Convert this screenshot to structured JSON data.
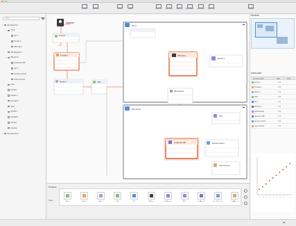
{
  "window": {
    "title": "",
    "traffic": [
      "#f2605a",
      "#f6be4f",
      "#5ec86e"
    ]
  },
  "toolbar": {
    "items": [
      {
        "label": "Connect",
        "icon": "connect-icon"
      },
      {
        "label": "Generate",
        "icon": "generate-icon"
      },
      {
        "label": "Search",
        "icon": "search-icon"
      },
      {
        "label": "Select",
        "icon": "pointer-icon"
      },
      {
        "label": "Align Left",
        "icon": "align-left-icon"
      },
      {
        "label": "Align Right",
        "icon": "align-right-icon"
      },
      {
        "label": "Align Top",
        "icon": "align-top-icon"
      },
      {
        "label": "Align Bottom",
        "icon": "align-bottom-icon"
      },
      {
        "label": "Space Horiz.",
        "icon": "space-horizontal-icon"
      },
      {
        "label": "Space Vert.",
        "icon": "space-vertical-icon"
      },
      {
        "label": "Inspector",
        "icon": "inspector-icon"
      }
    ]
  },
  "sidebar": {
    "search_placeholder": "Filter",
    "items": [
      {
        "label": "My Network 1",
        "level": 0,
        "twisty": "▾"
      },
      {
        "label": "DC 2",
        "level": 1,
        "twisty": "▾"
      },
      {
        "label": "AP 1",
        "level": 2,
        "twisty": ""
      },
      {
        "label": "Router 1",
        "level": 2,
        "twisty": ""
      },
      {
        "label": "DB Client",
        "level": 2,
        "twisty": ""
      },
      {
        "label": "DB Requests",
        "level": 1,
        "twisty": ""
      },
      {
        "label": "DB server",
        "level": 1,
        "twisty": "▾"
      },
      {
        "label": "Customer DB",
        "level": 2,
        "twisty": ""
      },
      {
        "label": "AP 2",
        "level": 2,
        "twisty": ""
      },
      {
        "label": "Access Control",
        "level": 2,
        "twisty": ""
      },
      {
        "label": "User Account",
        "level": 2,
        "twisty": ""
      },
      {
        "label": "User",
        "level": 1,
        "twisty": ""
      },
      {
        "label": "Internet",
        "level": 1,
        "twisty": ""
      },
      {
        "label": "Router 2",
        "level": 1,
        "twisty": ""
      },
      {
        "label": "Firewall 2",
        "level": 1,
        "twisty": ""
      },
      {
        "label": "SW1",
        "level": 1,
        "twisty": ""
      },
      {
        "label": "Router 1",
        "level": 1,
        "twisty": ""
      },
      {
        "label": "Firewall 1",
        "level": 1,
        "twisty": ""
      },
      {
        "label": "Internet",
        "level": 1,
        "twisty": ""
      },
      {
        "label": "Attacker",
        "level": 1,
        "twisty": ""
      },
      {
        "label": "My Network 2",
        "level": 0,
        "twisty": "▸"
      }
    ]
  },
  "canvas": {
    "attacker": "Attacker",
    "internet": "Internet",
    "firewall": "Firewall 1",
    "router": "Router 1",
    "sw": "SW2",
    "dc2": "DC 2",
    "dbclient": "DB Client",
    "router_right": "Router 1",
    "dbrequests": "DB requests",
    "dbserver": "DB server",
    "ap1": "AP 1",
    "customerdb": "Customer DB",
    "access": "Access Control",
    "useraccount": "User Account",
    "rows_small": [
      "Attributes",
      "Vulnerabilities",
      "Assets"
    ]
  },
  "timeline": {
    "label": "Timeline",
    "steps_label": "Steps",
    "nodes": [
      {
        "caption": "Internet",
        "num": "0",
        "color": "#7cc47a"
      },
      {
        "caption": "Firewall 1",
        "num": "1",
        "color": "#f0a04b"
      },
      {
        "caption": "Router 1",
        "num": "2",
        "color": "#a0a8b8"
      },
      {
        "caption": "SW2",
        "num": "3",
        "color": "#7cc47a"
      },
      {
        "caption": "DC 2",
        "num": "4",
        "color": "#4f8fd8"
      },
      {
        "caption": "DB Client",
        "num": "5",
        "color": "#3a3a3a"
      },
      {
        "caption": "DB Requests",
        "num": "6",
        "color": "#9e7fd3"
      },
      {
        "caption": "AP 1",
        "num": "7",
        "color": "#9e7fd3"
      },
      {
        "caption": "Customer DB",
        "num": "8",
        "color": "#7e6fc7"
      },
      {
        "caption": "Access Control",
        "num": "9",
        "color": "#6aa0d8"
      },
      {
        "caption": "User Account",
        "num": "10",
        "color": "#d6a86a"
      }
    ]
  },
  "rightpanel": {
    "overview_label": "Overview",
    "attack_label": "Attack paths",
    "table_headers": [
      "Customer DB",
      "Risk",
      "Time"
    ],
    "rows": [
      {
        "name": "Internet",
        "value": "1 hr",
        "color": "#7cc47a"
      },
      {
        "name": "Firewall 1",
        "value": "1 hr",
        "color": "#f0a04b"
      },
      {
        "name": "Router 1",
        "value": "1 hr",
        "color": "#a0a8b8"
      },
      {
        "name": "SW2",
        "value": "1 hr",
        "color": "#7cc47a"
      },
      {
        "name": "DC 2",
        "value": "1 hr",
        "color": "#4f8fd8"
      },
      {
        "name": "DB Client",
        "value": "1 hr",
        "color": "#6a6a6a"
      },
      {
        "name": "DB Requests",
        "value": "1 hr",
        "color": "#9e7fd3"
      },
      {
        "name": "Customer DB",
        "value": "1 hr",
        "color": "#7e6fc7"
      },
      {
        "name": "Access Control",
        "value": "1 hr",
        "color": "#6aa0d8"
      },
      {
        "name": "User Account",
        "value": "1 hr",
        "color": "#d6a86a"
      }
    ]
  },
  "status": {
    "count": "37"
  },
  "chart_data": {
    "type": "scatter",
    "title": "",
    "xlabel": "",
    "ylabel": "",
    "x": [
      "A",
      "B",
      "C",
      "D",
      "E",
      "F",
      "G",
      "H",
      "I",
      "J"
    ],
    "values": [
      1,
      1.5,
      2,
      2.6,
      3.1,
      3.6,
      4.2,
      4.7,
      5.2,
      5.8
    ],
    "ylim": [
      0,
      7
    ],
    "color": "#c0392b"
  },
  "colors": {
    "accent": "#e25b2f",
    "node_border": "#c8ccd4",
    "link": "#e88a6a",
    "frame": "#6a6f78"
  }
}
